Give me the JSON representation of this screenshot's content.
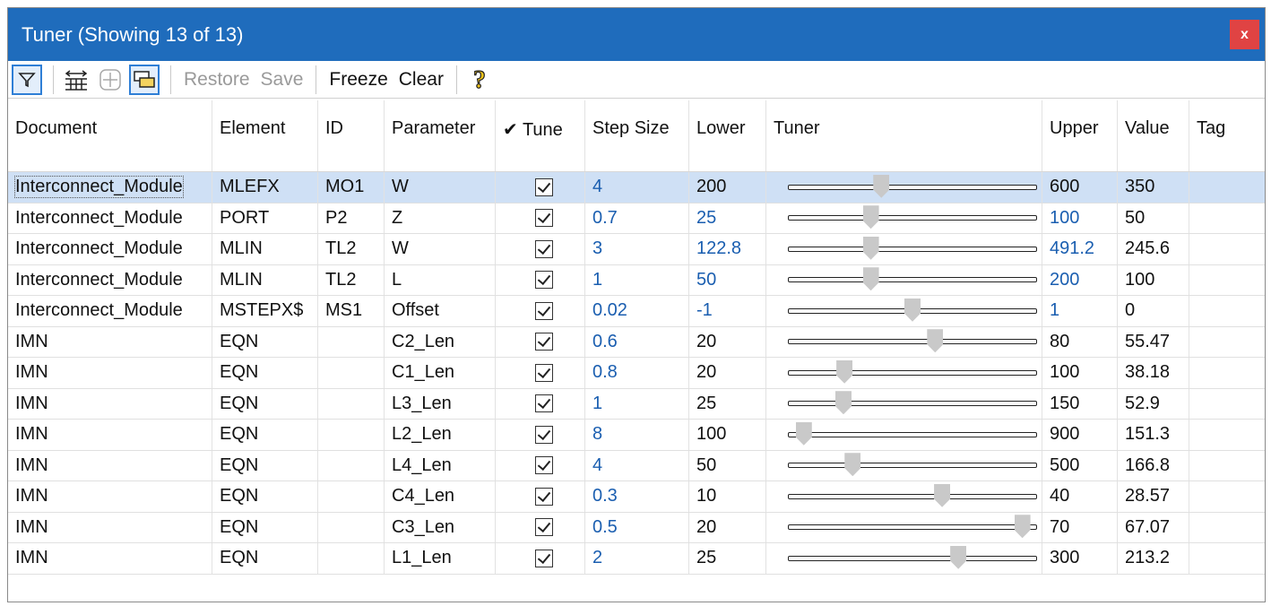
{
  "window": {
    "title": "Tuner (Showing 13 of 13)",
    "close_label": "x"
  },
  "toolbar": {
    "icons": [
      "filter-icon",
      "column-width-icon",
      "move-crosshair-icon",
      "window-toggle-icon",
      "help-question-icon"
    ],
    "restore_label": "Restore",
    "save_label": "Save",
    "freeze_label": "Freeze",
    "clear_label": "Clear",
    "help_glyph": "?"
  },
  "columns": [
    "Document",
    "Element",
    "ID",
    "Parameter",
    "✔ Tune",
    "Step Size",
    "Lower",
    "Tuner",
    "Upper",
    "Value",
    "Tag"
  ],
  "colors": {
    "title_bar": "#1f6cbc",
    "close": "#e04343",
    "link_blue": "#1a5eb0",
    "selected_row": "#cfe0f5"
  },
  "rows": [
    {
      "document": "Interconnect_Module",
      "element": "MLEFX",
      "id": "MO1",
      "parameter": "W",
      "tune": true,
      "step": "4",
      "lower": "200",
      "upper": "600",
      "value": "350",
      "tag": "",
      "tuner_fraction": 0.375,
      "step_blue": true,
      "lower_blue": false,
      "upper_blue": false,
      "selected": true
    },
    {
      "document": "Interconnect_Module",
      "element": "PORT",
      "id": "P2",
      "parameter": "Z",
      "tune": true,
      "step": "0.7",
      "lower": "25",
      "upper": "100",
      "value": "50",
      "tag": "",
      "tuner_fraction": 0.333,
      "step_blue": true,
      "lower_blue": true,
      "upper_blue": true,
      "selected": false
    },
    {
      "document": "Interconnect_Module",
      "element": "MLIN",
      "id": "TL2",
      "parameter": "W",
      "tune": true,
      "step": "3",
      "lower": "122.8",
      "upper": "491.2",
      "value": "245.6",
      "tag": "",
      "tuner_fraction": 0.333,
      "step_blue": true,
      "lower_blue": true,
      "upper_blue": true,
      "selected": false
    },
    {
      "document": "Interconnect_Module",
      "element": "MLIN",
      "id": "TL2",
      "parameter": "L",
      "tune": true,
      "step": "1",
      "lower": "50",
      "upper": "200",
      "value": "100",
      "tag": "",
      "tuner_fraction": 0.333,
      "step_blue": true,
      "lower_blue": true,
      "upper_blue": true,
      "selected": false
    },
    {
      "document": "Interconnect_Module",
      "element": "MSTEPX$",
      "id": "MS1",
      "parameter": "Offset",
      "tune": true,
      "step": "0.02",
      "lower": "-1",
      "upper": "1",
      "value": "0",
      "tag": "",
      "tuner_fraction": 0.5,
      "step_blue": true,
      "lower_blue": true,
      "upper_blue": true,
      "selected": false
    },
    {
      "document": "IMN",
      "element": "EQN",
      "id": "",
      "parameter": "C2_Len",
      "tune": true,
      "step": "0.6",
      "lower": "20",
      "upper": "80",
      "value": "55.47",
      "tag": "",
      "tuner_fraction": 0.591,
      "step_blue": true,
      "lower_blue": false,
      "upper_blue": false,
      "selected": false
    },
    {
      "document": "IMN",
      "element": "EQN",
      "id": "",
      "parameter": "C1_Len",
      "tune": true,
      "step": "0.8",
      "lower": "20",
      "upper": "100",
      "value": "38.18",
      "tag": "",
      "tuner_fraction": 0.227,
      "step_blue": true,
      "lower_blue": false,
      "upper_blue": false,
      "selected": false
    },
    {
      "document": "IMN",
      "element": "EQN",
      "id": "",
      "parameter": "L3_Len",
      "tune": true,
      "step": "1",
      "lower": "25",
      "upper": "150",
      "value": "52.9",
      "tag": "",
      "tuner_fraction": 0.223,
      "step_blue": true,
      "lower_blue": false,
      "upper_blue": false,
      "selected": false
    },
    {
      "document": "IMN",
      "element": "EQN",
      "id": "",
      "parameter": "L2_Len",
      "tune": true,
      "step": "8",
      "lower": "100",
      "upper": "900",
      "value": "151.3",
      "tag": "",
      "tuner_fraction": 0.064,
      "step_blue": true,
      "lower_blue": false,
      "upper_blue": false,
      "selected": false
    },
    {
      "document": "IMN",
      "element": "EQN",
      "id": "",
      "parameter": "L4_Len",
      "tune": true,
      "step": "4",
      "lower": "50",
      "upper": "500",
      "value": "166.8",
      "tag": "",
      "tuner_fraction": 0.26,
      "step_blue": true,
      "lower_blue": false,
      "upper_blue": false,
      "selected": false
    },
    {
      "document": "IMN",
      "element": "EQN",
      "id": "",
      "parameter": "C4_Len",
      "tune": true,
      "step": "0.3",
      "lower": "10",
      "upper": "40",
      "value": "28.57",
      "tag": "",
      "tuner_fraction": 0.619,
      "step_blue": true,
      "lower_blue": false,
      "upper_blue": false,
      "selected": false
    },
    {
      "document": "IMN",
      "element": "EQN",
      "id": "",
      "parameter": "C3_Len",
      "tune": true,
      "step": "0.5",
      "lower": "20",
      "upper": "70",
      "value": "67.07",
      "tag": "",
      "tuner_fraction": 0.941,
      "step_blue": true,
      "lower_blue": false,
      "upper_blue": false,
      "selected": false
    },
    {
      "document": "IMN",
      "element": "EQN",
      "id": "",
      "parameter": "L1_Len",
      "tune": true,
      "step": "2",
      "lower": "25",
      "upper": "300",
      "value": "213.2",
      "tag": "",
      "tuner_fraction": 0.684,
      "step_blue": true,
      "lower_blue": false,
      "upper_blue": false,
      "selected": false
    }
  ]
}
